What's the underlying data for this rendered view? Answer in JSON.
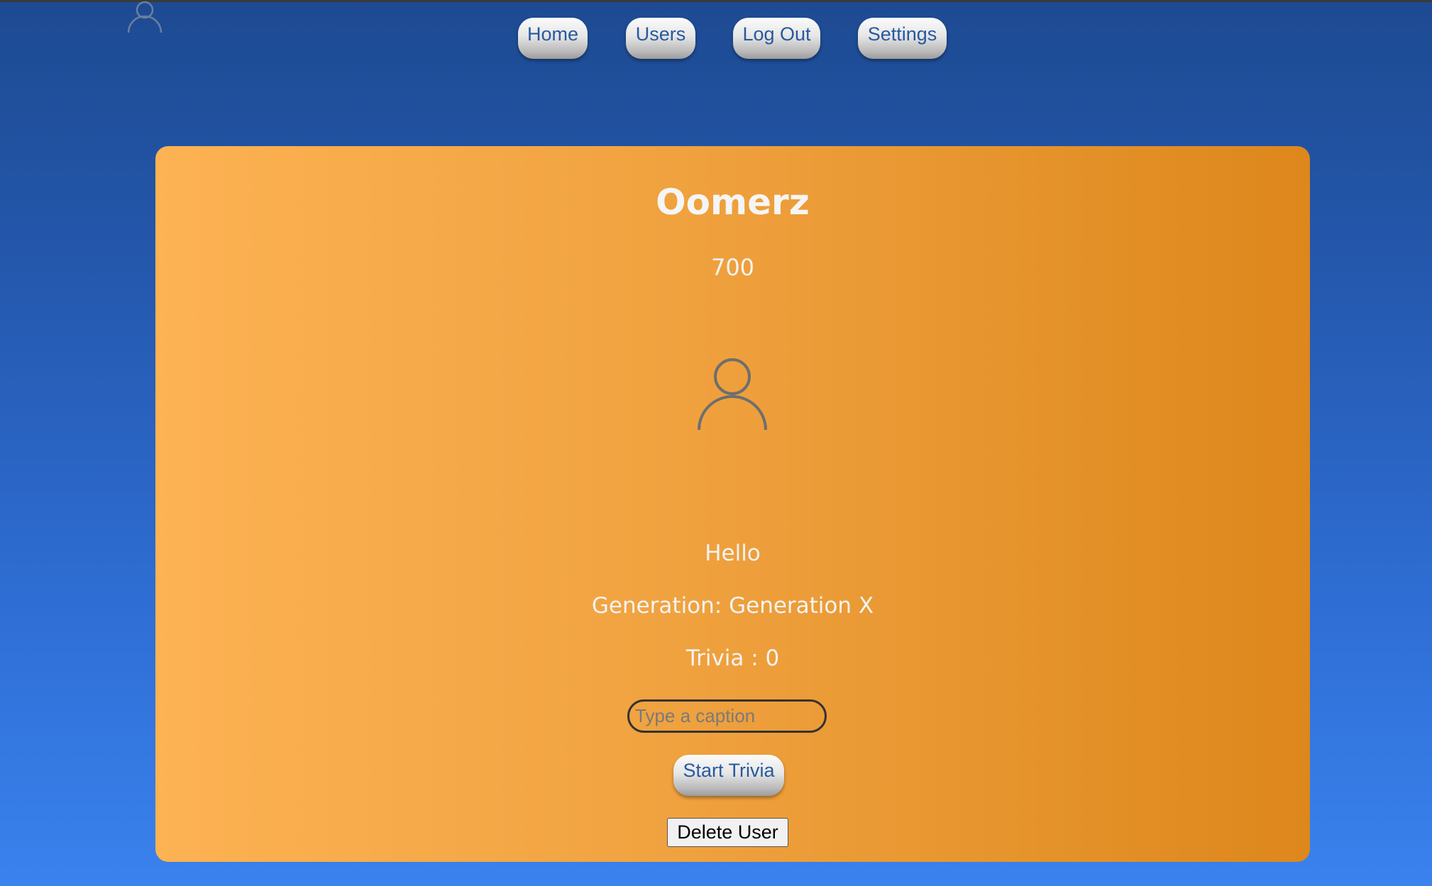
{
  "nav": {
    "items": [
      {
        "label": "Home"
      },
      {
        "label": "Users"
      },
      {
        "label": "Log Out"
      },
      {
        "label": "Settings"
      }
    ]
  },
  "profile": {
    "username": "Oomerz",
    "points": "700",
    "caption": "Hello",
    "generation": "Generation: Generation X",
    "trivia": "Trivia : 0"
  },
  "form": {
    "caption_placeholder": "Type a caption",
    "start_trivia_label": "Start Trivia",
    "delete_user_label": "Delete User"
  },
  "icons": {
    "corner": "user-icon",
    "profile": "user-icon"
  },
  "colors": {
    "background_top": "#1d4a92",
    "background_bottom": "#3a82ee",
    "card_left": "#fdb253",
    "card_right": "#dd871c",
    "nav_text": "#27599f"
  }
}
